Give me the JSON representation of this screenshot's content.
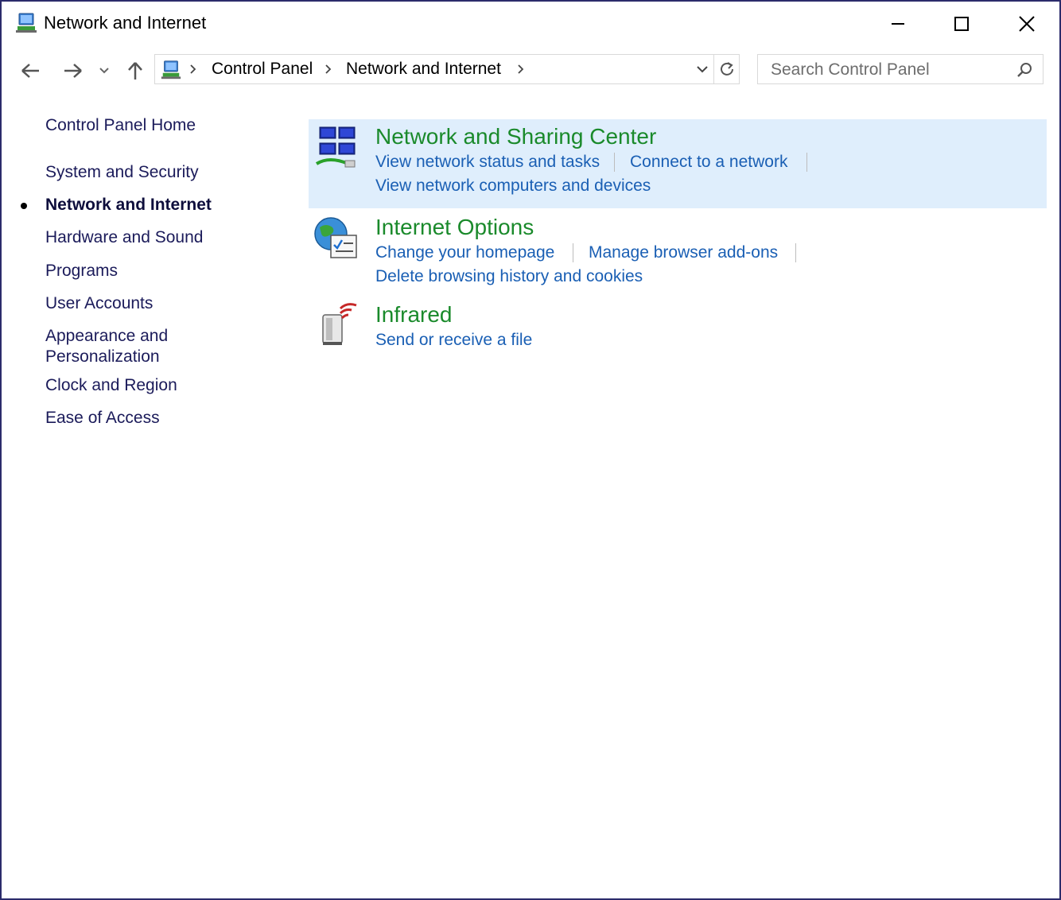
{
  "window": {
    "title": "Network and Internet"
  },
  "address_bar": {
    "crumbs": [
      "Control Panel",
      "Network and Internet"
    ]
  },
  "search": {
    "placeholder": "Search Control Panel"
  },
  "sidebar": {
    "items": [
      {
        "label": "Control Panel Home"
      },
      {
        "label": "System and Security"
      },
      {
        "label": "Network and Internet",
        "current": true
      },
      {
        "label": "Hardware and Sound"
      },
      {
        "label": "Programs"
      },
      {
        "label": "User Accounts"
      },
      {
        "label": "Appearance and"
      },
      {
        "label": "Personalization"
      },
      {
        "label": "Clock and Region"
      },
      {
        "label": "Ease of Access"
      }
    ]
  },
  "categories": [
    {
      "title": "Network and Sharing Center",
      "icon": "network-sharing-icon",
      "tasks": [
        "View network status and tasks",
        "Connect to a network",
        "View network computers and devices"
      ]
    },
    {
      "title": "Internet Options",
      "icon": "internet-options-icon",
      "tasks": [
        "Change your homepage",
        "Manage browser add-ons",
        "Delete browsing history and cookies"
      ]
    },
    {
      "title": "Infrared",
      "icon": "infrared-icon",
      "tasks": [
        "Send or receive a file"
      ]
    }
  ],
  "colors": {
    "title_green": "#1a8a2b",
    "link_blue": "#1a5fb4",
    "selected_bg": "#dfeefc",
    "window_border": "#2b2b6b"
  }
}
